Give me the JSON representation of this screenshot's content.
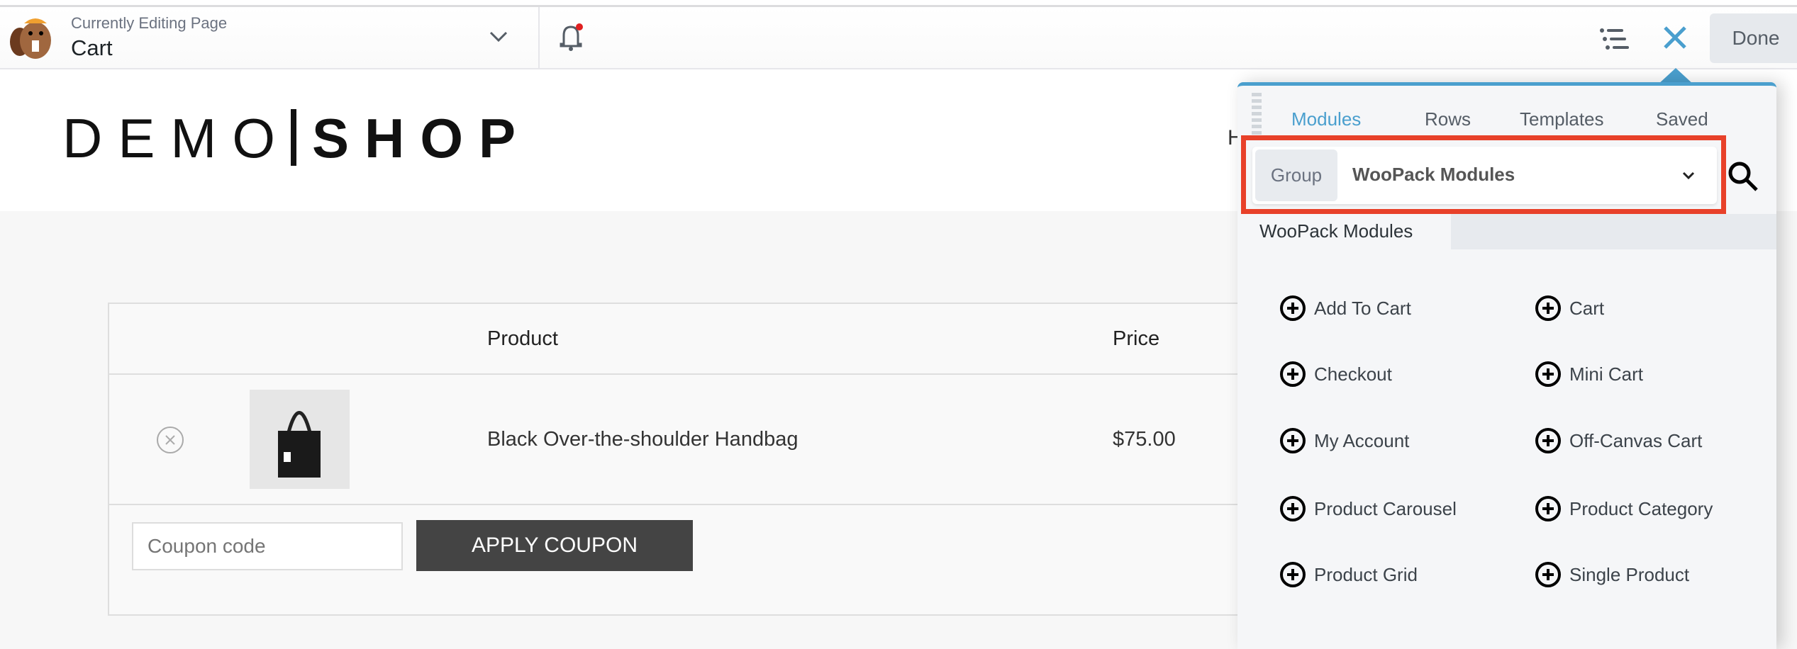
{
  "topbar": {
    "subtitle": "Currently Editing Page",
    "page_name": "Cart",
    "done_label": "Done"
  },
  "site": {
    "logo_left": "DEMO",
    "logo_right": "SHOP",
    "nav_partial": "H"
  },
  "cart": {
    "headers": [
      "Product",
      "Price"
    ],
    "items": [
      {
        "name": "Black Over-the-shoulder Handbag",
        "price": "$75.00"
      }
    ],
    "coupon_placeholder": "Coupon code",
    "apply_label": "APPLY COUPON"
  },
  "panel": {
    "tabs": [
      "Modules",
      "Rows",
      "Templates",
      "Saved"
    ],
    "active_tab": "Modules",
    "group_label": "Group",
    "group_value": "WooPack Modules",
    "section_title": "WooPack Modules",
    "modules": [
      "Add To Cart",
      "Cart",
      "Checkout",
      "Mini Cart",
      "My Account",
      "Off-Canvas Cart",
      "Product Carousel",
      "Product Category",
      "Product Grid",
      "Single Product"
    ]
  },
  "colors": {
    "accent": "#4a9fce",
    "highlight": "#e8412a",
    "button_dark": "#444444"
  }
}
